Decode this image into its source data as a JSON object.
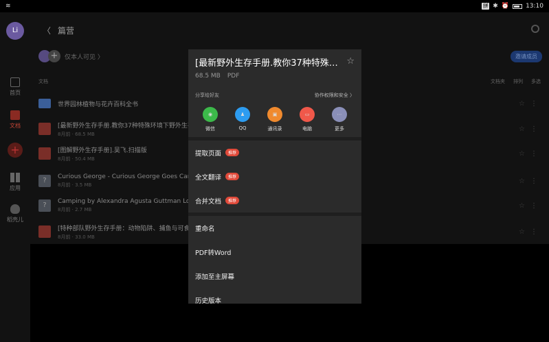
{
  "statusbar": {
    "time": "13:10",
    "ime": "拼"
  },
  "rail": {
    "avatar": "Li",
    "items": [
      {
        "label": "首页"
      },
      {
        "label": "文档"
      },
      {
        "label": "应用"
      },
      {
        "label": "稻壳儿"
      }
    ]
  },
  "header": {
    "title": " 篇营"
  },
  "members": {
    "text": "仅本人可见 〉"
  },
  "members_button": "邀请成员",
  "list": {
    "header": "文档",
    "tools": [
      "文档夹",
      "排列",
      "多选"
    ],
    "rows": [
      {
        "name": "世界园林植物与花卉百科全书",
        "meta": "",
        "type": "folder"
      },
      {
        "name": "[最新野外生存手册.教你37种特殊环境下野外生存",
        "meta": "8月前 · 68.5 MB",
        "type": "pdf"
      },
      {
        "name": "[图解野外生存手册].吴飞.扫描版",
        "meta": "8月前 · 50.4 MB",
        "type": "pdf"
      },
      {
        "name": "Curious George - Curious George Goes Camp",
        "meta": "8月前 · 3.5 MB",
        "type": "unk"
      },
      {
        "name": "Camping by Alexandra Agusta Guttman Lock",
        "meta": "8月前 · 2.7 MB",
        "type": "unk"
      },
      {
        "name": "[特种部队野外生存手册：动物陷阱、捕鱼与可食",
        "meta": "8月前 · 33.0 MB",
        "type": "pdf"
      }
    ]
  },
  "sheet": {
    "title": "[最新野外生存手册.教你37种特殊…",
    "size": "68.5 MB",
    "type": "PDF",
    "share_label": "分享给好友",
    "perm_label": "协作权限和安全 〉",
    "apps": [
      {
        "label": "微信",
        "color": "#3cb94a",
        "glyph": "◉"
      },
      {
        "label": "QQ",
        "color": "#2d9cf0",
        "glyph": "♟"
      },
      {
        "label": "通讯录",
        "color": "#f08a2e",
        "glyph": "▣"
      },
      {
        "label": "电脑",
        "color": "#f0584a",
        "glyph": "▭"
      },
      {
        "label": "更多",
        "color": "#8a8fb8",
        "glyph": "⋯"
      }
    ],
    "menu_group1": [
      {
        "label": "提取页面",
        "tag": "推荐"
      },
      {
        "label": "全文翻译",
        "tag": "推荐"
      },
      {
        "label": "合并文档",
        "tag": "推荐"
      }
    ],
    "menu_group2": [
      {
        "label": "重命名"
      },
      {
        "label": "PDF转Word"
      },
      {
        "label": "添加至主屏幕"
      },
      {
        "label": "历史版本"
      }
    ]
  }
}
